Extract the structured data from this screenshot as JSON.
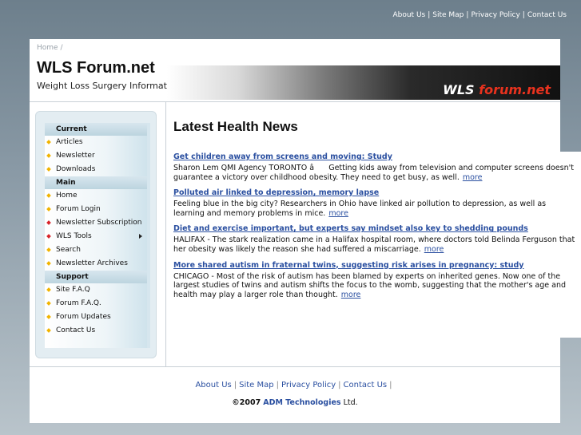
{
  "top_nav": {
    "links": [
      "About Us",
      "Site Map",
      "Privacy Policy",
      "Contact Us"
    ],
    "separator": "|"
  },
  "breadcrumb": "Home /",
  "site": {
    "title": "WLS Forum.net",
    "subtitle": "Weight Loss Surgery Information Portal",
    "banner_logo_part1": "WLS",
    "banner_logo_part2": "forum.net"
  },
  "sidebar": {
    "sections": [
      {
        "heading": "Current",
        "items": [
          {
            "label": "Articles",
            "bullet": "yellow"
          },
          {
            "label": "Newsletter",
            "bullet": "yellow"
          },
          {
            "label": "Downloads",
            "bullet": "yellow"
          }
        ]
      },
      {
        "heading": "Main",
        "items": [
          {
            "label": "Home",
            "bullet": "yellow"
          },
          {
            "label": "Forum Login",
            "bullet": "yellow"
          },
          {
            "label": "Newsletter Subscription",
            "bullet": "red"
          },
          {
            "label": "WLS Tools",
            "bullet": "red",
            "submenu": true
          },
          {
            "label": "Search",
            "bullet": "yellow"
          },
          {
            "label": "Newsletter Archives",
            "bullet": "yellow"
          }
        ]
      },
      {
        "heading": "Support",
        "items": [
          {
            "label": "Site F.A.Q",
            "bullet": "yellow"
          },
          {
            "label": "Forum F.A.Q.",
            "bullet": "yellow"
          },
          {
            "label": "Forum Updates",
            "bullet": "yellow"
          },
          {
            "label": "Contact Us",
            "bullet": "yellow"
          }
        ]
      }
    ]
  },
  "main": {
    "heading": "Latest Health News",
    "more_label": "more",
    "news": [
      {
        "title": "Get children away from screens and moving: Study",
        "body": "Sharon Lem QMI Agency TORONTO â Getting kids away from television and computer screens doesn't guarantee a victory over childhood obesity. They need to get busy, as well."
      },
      {
        "title": "Polluted air linked to depression, memory lapse",
        "body": "Feeling blue in the big city? Researchers in Ohio have linked air pollution to depression, as well as learning and memory problems in mice."
      },
      {
        "title": "Diet and exercise important, but experts say mindset also key to shedding pounds",
        "body": "HALIFAX - The stark realization came in a Halifax hospital room, where doctors told Belinda Ferguson that her obesity was likely the reason she had suffered a miscarriage."
      },
      {
        "title": "More shared autism in fraternal twins, suggesting risk arises in pregnancy: study",
        "body": "CHICAGO - Most of the risk of autism has been blamed by experts on inherited genes. Now one of the largest studies of twins and autism shifts the focus to the womb, suggesting that the mother's age and health may play a larger role than thought."
      }
    ]
  },
  "footer": {
    "links": [
      "About Us",
      "Site Map",
      "Privacy Policy",
      "Contact Us"
    ],
    "separator": "|",
    "copyright_prefix": "©2007",
    "company": "ADM Technologies",
    "suffix": "Ltd."
  }
}
